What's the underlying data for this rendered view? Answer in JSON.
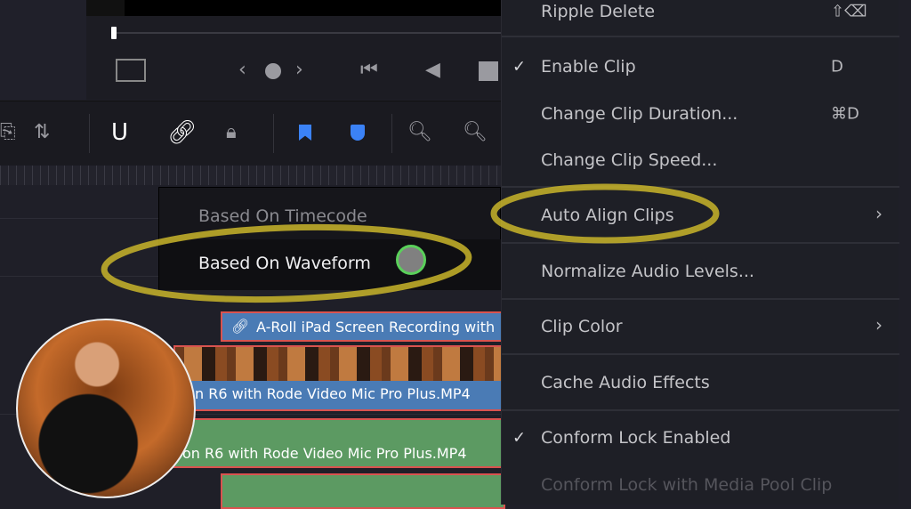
{
  "menu": {
    "items": [
      {
        "label": "Ripple Delete",
        "shortcut": "⇧⌫",
        "checked": false,
        "submenu": false,
        "disabled": false
      },
      {
        "label": "Enable Clip",
        "shortcut": "D",
        "checked": true,
        "submenu": false,
        "disabled": false
      },
      {
        "label": "Change Clip Duration...",
        "shortcut": "⌘D",
        "checked": false,
        "submenu": false,
        "disabled": false
      },
      {
        "label": "Change Clip Speed...",
        "shortcut": "",
        "checked": false,
        "submenu": false,
        "disabled": false
      },
      {
        "label": "Auto Align Clips",
        "shortcut": "",
        "checked": false,
        "submenu": true,
        "disabled": false
      },
      {
        "label": "Normalize Audio Levels...",
        "shortcut": "",
        "checked": false,
        "submenu": false,
        "disabled": false
      },
      {
        "label": "Clip Color",
        "shortcut": "",
        "checked": false,
        "submenu": true,
        "disabled": false
      },
      {
        "label": "Cache Audio Effects",
        "shortcut": "",
        "checked": false,
        "submenu": false,
        "disabled": false
      },
      {
        "label": "Conform Lock Enabled",
        "shortcut": "",
        "checked": true,
        "submenu": false,
        "disabled": false
      },
      {
        "label": "Conform Lock with Media Pool Clip",
        "shortcut": "",
        "checked": false,
        "submenu": false,
        "disabled": true
      }
    ],
    "check_glyph": "✓",
    "arrow_glyph": "›"
  },
  "submenu": {
    "items": [
      {
        "label": "Based On Timecode",
        "highlighted": false
      },
      {
        "label": "Based On Waveform",
        "highlighted": true
      }
    ]
  },
  "timeline": {
    "clips": [
      {
        "label": "A-Roll iPad Screen Recording with",
        "type": "video-label",
        "color": "#4a7bb5"
      },
      {
        "label": "n R6 with Rode Video Mic Pro Plus.MP4",
        "type": "video",
        "color": "#4a7bb5"
      },
      {
        "label": "on R6 with Rode Video Mic Pro Plus.MP4",
        "type": "audio",
        "color": "#5c9a62"
      },
      {
        "label": "",
        "type": "audio",
        "color": "#5c9a62"
      }
    ]
  },
  "toolbar": {
    "icons": [
      "insert-icon",
      "overwrite-icon",
      "snapping-magnet-icon",
      "linked-selection-icon",
      "position-lock-icon",
      "flag-icon",
      "marker-icon",
      "zoom-full-icon",
      "zoom-detail-icon"
    ]
  },
  "colors": {
    "highlight": "#d4bf2a",
    "accent": "#3b82f6",
    "clip_border": "#d9534f",
    "cursor_ring": "#5ad05a"
  }
}
